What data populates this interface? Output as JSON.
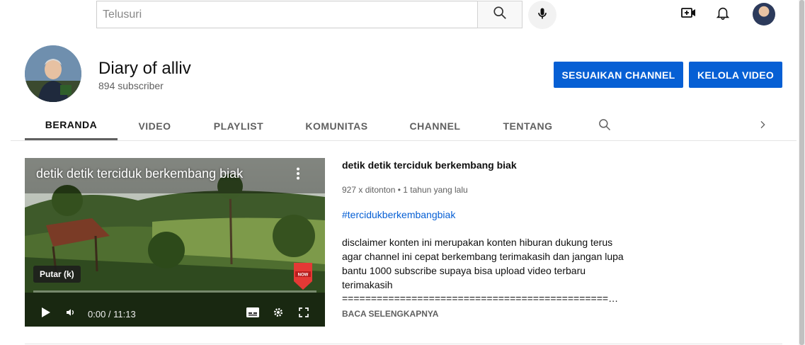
{
  "search": {
    "placeholder": "Telusuri"
  },
  "channel": {
    "name": "Diary of alliv",
    "subscribers": "894 subscriber",
    "customize_label": "SESUAIKAN CHANNEL",
    "manage_label": "KELOLA VIDEO"
  },
  "tabs": [
    {
      "label": "BERANDA",
      "active": true
    },
    {
      "label": "VIDEO"
    },
    {
      "label": "PLAYLIST"
    },
    {
      "label": "KOMUNITAS"
    },
    {
      "label": "CHANNEL"
    },
    {
      "label": "TENTANG"
    }
  ],
  "player": {
    "overlay_title": "detik detik terciduk berkembang biak",
    "tooltip": "Putar (k)",
    "time": "0:00 / 11:13",
    "progress": 0,
    "badge_text": "NOW"
  },
  "video": {
    "title": "detik detik terciduk berkembang biak",
    "meta": "927 x ditonton • 1 tahun yang lalu",
    "hashtag": "#tercidukberkembangbiak",
    "description": "disclaimer konten ini merupakan konten hiburan dukung terus agar channel ini cepat berkembang terimakasih dan jangan lupa bantu 1000 subscribe  supaya bisa upload video terbaru terimakasih",
    "separator": "=======================================================================",
    "read_more": "BACA SELENGKAPNYA"
  },
  "colors": {
    "accent": "#065fd4",
    "text_secondary": "#606060"
  },
  "icons": [
    "search-icon",
    "mic-icon",
    "create-video-icon",
    "bell-icon",
    "more-vert-icon",
    "play-icon",
    "volume-icon",
    "subtitles-icon",
    "gear-icon",
    "fullscreen-icon",
    "chevron-right-icon"
  ]
}
